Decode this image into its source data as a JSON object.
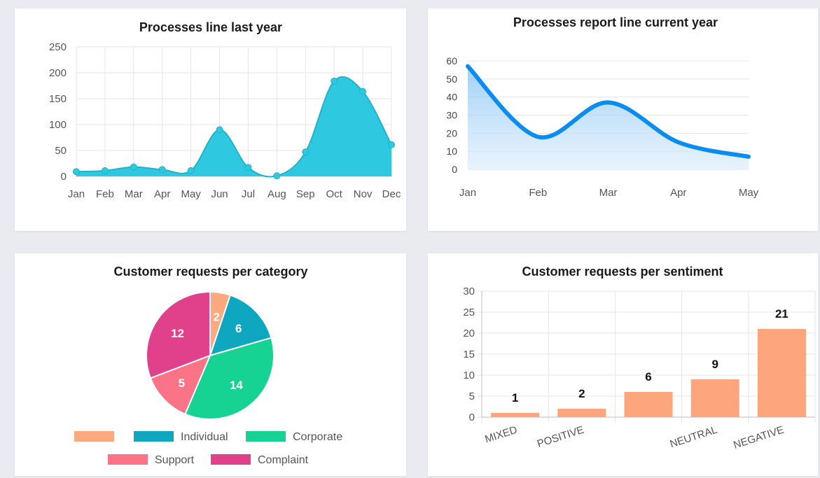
{
  "chart_data": [
    {
      "type": "area",
      "title": "Processes line last year",
      "x": [
        "Jan",
        "Feb",
        "Mar",
        "Apr",
        "May",
        "Jun",
        "Jul",
        "Aug",
        "Sep",
        "Oct",
        "Nov",
        "Dec"
      ],
      "values": [
        9,
        11,
        18,
        13,
        11,
        90,
        17,
        1,
        47,
        184,
        164,
        61
      ],
      "ylim": [
        0,
        250
      ],
      "yticks": [
        0,
        50,
        100,
        150,
        200,
        250
      ],
      "grid": true,
      "color": "#2ec9e0",
      "line_color": "#21b3c9"
    },
    {
      "type": "area",
      "title": "Processes report line current year",
      "x": [
        "Jan",
        "Feb",
        "Mar",
        "Apr",
        "May"
      ],
      "values": [
        57,
        18,
        37,
        15,
        7
      ],
      "ylim": [
        0,
        60
      ],
      "yticks": [
        0,
        10,
        20,
        30,
        40,
        50,
        60
      ],
      "grid": true,
      "color": "#0a8cf0"
    },
    {
      "type": "pie",
      "title": "Customer requests per category",
      "slices": [
        {
          "label": "",
          "value": 2,
          "color": "#fba97e"
        },
        {
          "label": "Individual",
          "value": 6,
          "color": "#0fa6c0"
        },
        {
          "label": "Corporate",
          "value": 14,
          "color": "#17d393"
        },
        {
          "label": "Support",
          "value": 5,
          "color": "#fb7387"
        },
        {
          "label": "Complaint",
          "value": 12,
          "color": "#e1408a"
        }
      ],
      "legend": "bottom"
    },
    {
      "type": "bar",
      "title": "Customer requests per sentiment",
      "categories": [
        "MIXED",
        "POSITIVE",
        "",
        "NEUTRAL",
        "NEGATIVE"
      ],
      "values": [
        1,
        2,
        6,
        9,
        21
      ],
      "ylim": [
        0,
        30
      ],
      "yticks": [
        0,
        5,
        10,
        15,
        20,
        25,
        30
      ],
      "grid": true,
      "color": "#fda57c"
    }
  ]
}
